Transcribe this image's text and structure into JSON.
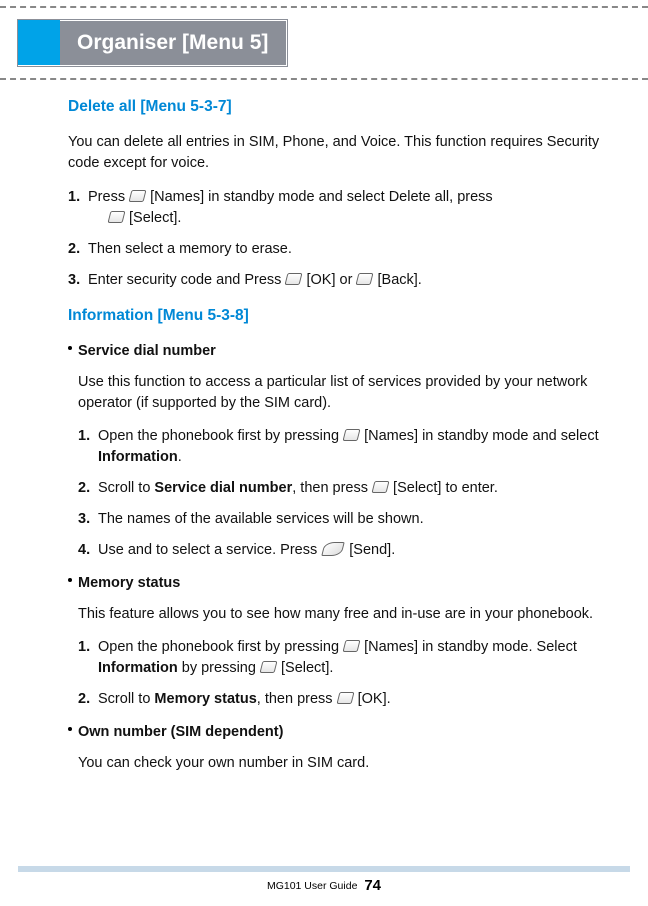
{
  "header": {
    "title": "Organiser [Menu 5]"
  },
  "s1": {
    "title": "Delete all [Menu 5-3-7]",
    "intro": "You can delete all entries in SIM, Phone, and Voice. This function requires Security code except for voice.",
    "items": [
      {
        "n": "1.",
        "a": "Press ",
        "b": " [Names] in standby mode and select Delete all, press",
        "c": " [Select]."
      },
      {
        "n": "2.",
        "a": "Then select a memory to erase."
      },
      {
        "n": "3.",
        "a": "Enter security code and Press ",
        "b": " [OK] or ",
        "c": " [Back]."
      }
    ]
  },
  "s2": {
    "title": "Information [Menu 5-3-8]",
    "sub1": {
      "label": "Service dial number",
      "intro": "Use this function to access a particular list of services provided by your network operator (if supported by the SIM card).",
      "items": [
        {
          "n": "1.",
          "a": "Open the phonebook first by pressing ",
          "b": " [Names] in standby mode and select ",
          "bold": "Information",
          "c": "."
        },
        {
          "n": "2.",
          "a": "Scroll to ",
          "bold": "Service dial number",
          "b": ", then press ",
          "c": " [Select] to enter."
        },
        {
          "n": "3.",
          "a": "The names of the available services will be shown."
        },
        {
          "n": "4.",
          "a": "Use and to select a service. Press ",
          "b": " [Send]."
        }
      ]
    },
    "sub2": {
      "label": "Memory status",
      "intro": "This feature allows you to see how many free and in-use are in your phonebook.",
      "items": [
        {
          "n": "1.",
          "a": "Open the phonebook first by pressing ",
          "b": " [Names] in standby mode. Select ",
          "bold": "Information",
          "c": " by pressing ",
          "d": " [Select]."
        },
        {
          "n": "2.",
          "a": "Scroll to ",
          "bold": "Memory status",
          "b": ", then press ",
          "c": " [OK]."
        }
      ]
    },
    "sub3": {
      "label": "Own number (SIM dependent)",
      "intro": "You can check your own number in SIM card."
    }
  },
  "footer": {
    "guide": "MG101 User Guide",
    "page": "74"
  }
}
